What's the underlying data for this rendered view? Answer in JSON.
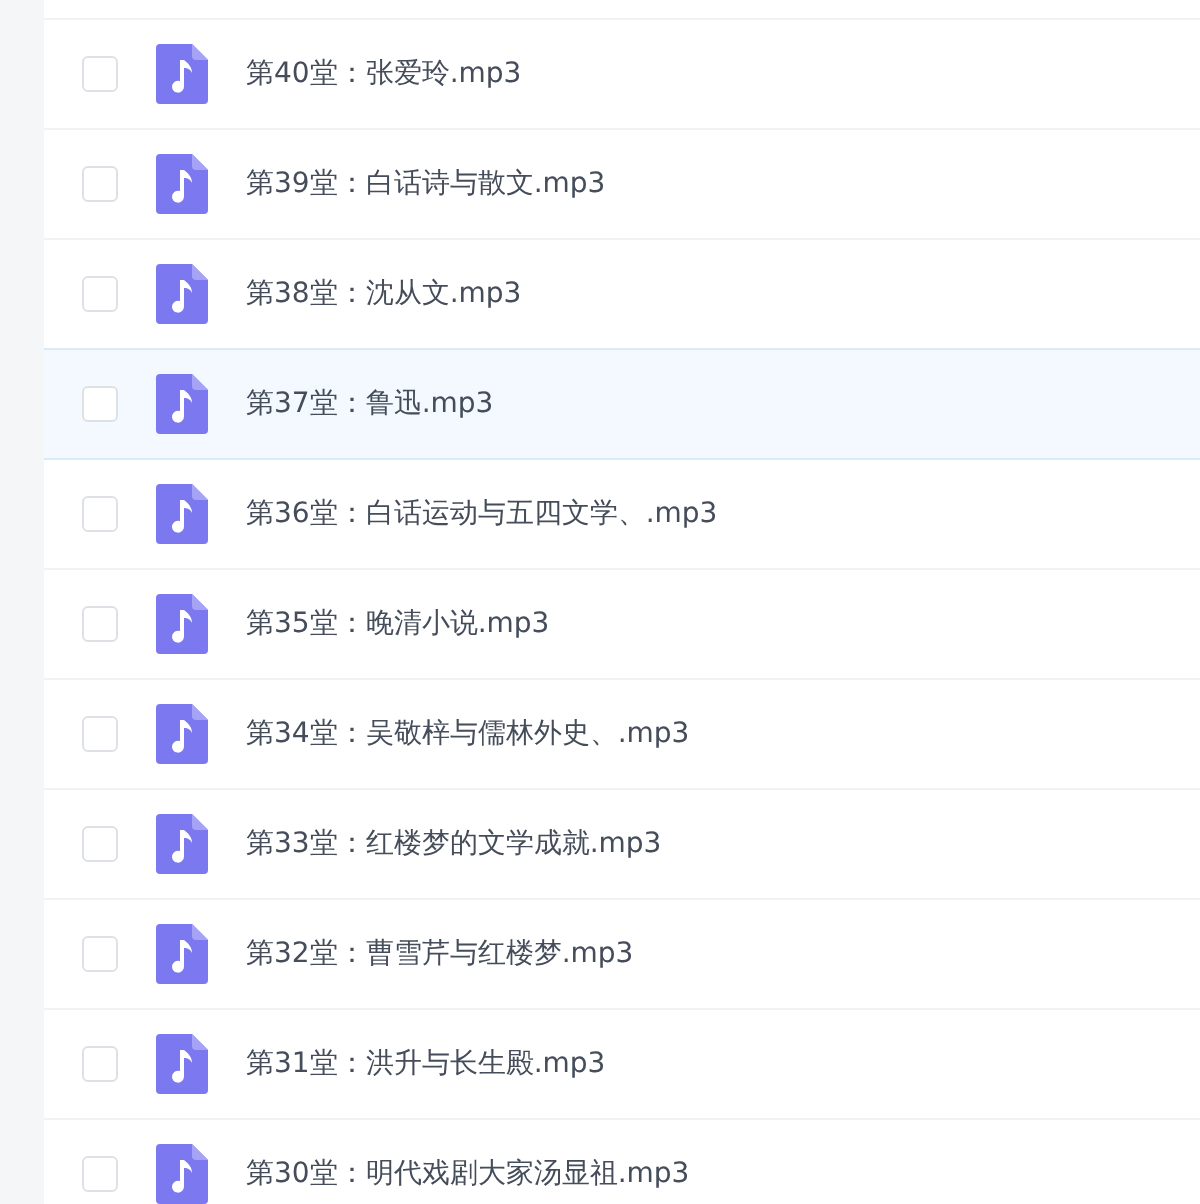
{
  "files": [
    {
      "name": "第40堂：张爱玲.mp3",
      "checked": false,
      "selected": false
    },
    {
      "name": "第39堂：白话诗与散文.mp3",
      "checked": false,
      "selected": false
    },
    {
      "name": "第38堂：沈从文.mp3",
      "checked": false,
      "selected": false
    },
    {
      "name": "第37堂：鲁迅.mp3",
      "checked": false,
      "selected": true
    },
    {
      "name": "第36堂：白话运动与五四文学、.mp3",
      "checked": false,
      "selected": false
    },
    {
      "name": "第35堂：晚清小说.mp3",
      "checked": false,
      "selected": false
    },
    {
      "name": "第34堂：吴敬梓与儒林外史、.mp3",
      "checked": false,
      "selected": false
    },
    {
      "name": "第33堂：红楼梦的文学成就.mp3",
      "checked": false,
      "selected": false
    },
    {
      "name": "第32堂：曹雪芹与红楼梦.mp3",
      "checked": false,
      "selected": false
    },
    {
      "name": "第31堂：洪升与长生殿.mp3",
      "checked": false,
      "selected": false
    },
    {
      "name": "第30堂：明代戏剧大家汤显祖.mp3",
      "checked": false,
      "selected": false
    }
  ]
}
